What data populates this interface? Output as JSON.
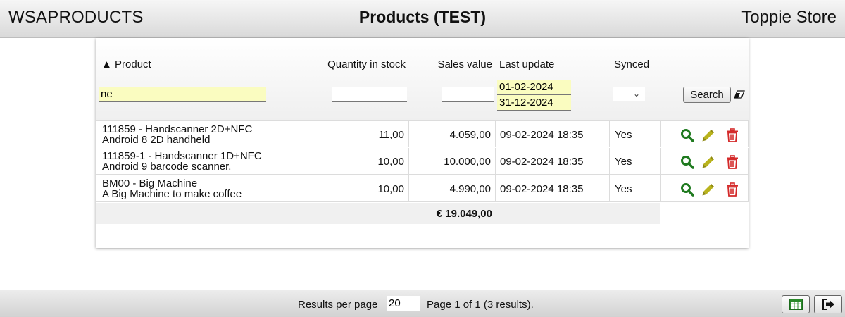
{
  "header": {
    "brand": "WSAPRODUCTS",
    "title": "Products (TEST)",
    "store": "Toppie Store"
  },
  "columns": {
    "product": "▲ Product",
    "quantity": "Quantity in stock",
    "sales": "Sales value",
    "last_update": "Last update",
    "synced": "Synced"
  },
  "filters": {
    "product": "ne",
    "quantity": "",
    "sales": "",
    "date_from": "01-02-2024",
    "date_to": "31-12-2024",
    "synced": "",
    "search_label": "Search"
  },
  "rows": [
    {
      "product_line1": "111859 - Handscanner 2D+NFC",
      "product_line2": "Android 8 2D handheld",
      "quantity": "11,00",
      "sales": "4.059,00",
      "last_update": "09-02-2024 18:35",
      "synced": "Yes"
    },
    {
      "product_line1": "111859-1 - Handscanner 1D+NFC",
      "product_line2": "Android 9 barcode scanner.",
      "quantity": "10,00",
      "sales": "10.000,00",
      "last_update": "09-02-2024 18:35",
      "synced": "Yes"
    },
    {
      "product_line1": "BM00 - Big Machine",
      "product_line2": "A Big Machine to make coffee",
      "quantity": "10,00",
      "sales": "4.990,00",
      "last_update": "09-02-2024 18:35",
      "synced": "Yes"
    }
  ],
  "total": "€ 19.049,00",
  "footer": {
    "rpp_label": "Results per page",
    "rpp_value": "20",
    "page_info": "Page 1 of 1 (3 results)."
  },
  "icons": {
    "search": "magnifier-icon",
    "edit": "pencil-icon",
    "delete": "trash-icon",
    "clear": "eraser-icon",
    "export": "spreadsheet-icon",
    "logout": "exit-icon"
  },
  "colors": {
    "search_icon": "#1f7a1f",
    "edit_icon": "#b9b31c",
    "delete_icon": "#d42a2a",
    "filter_highlight": "#fafcc0"
  }
}
